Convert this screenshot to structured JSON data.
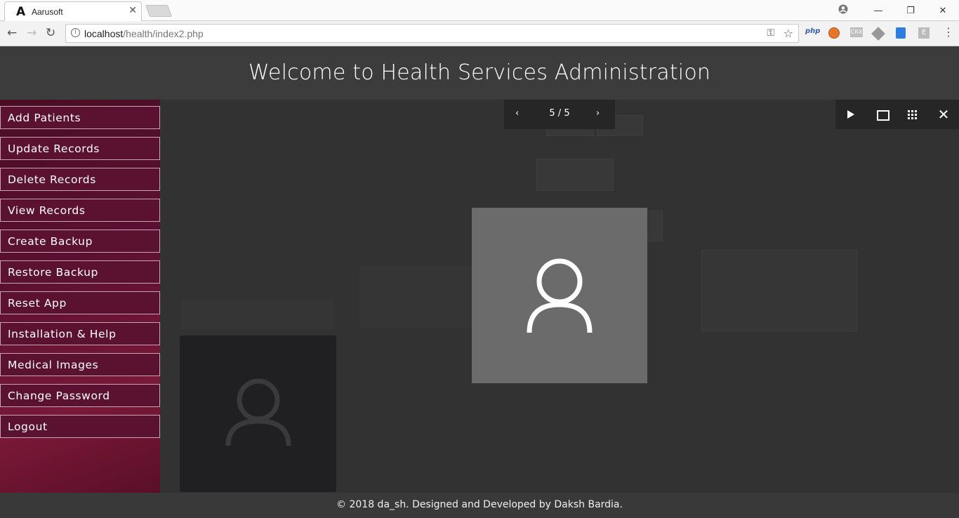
{
  "browser": {
    "tab_title": "Aarusoft",
    "tab_logo": "A",
    "tab_close": "✕",
    "url_host": "localhost",
    "url_path": "/health/index2.php",
    "ext_php": "php",
    "ext_crx": "CRX",
    "ext_e": "E",
    "window_minimize": "—",
    "window_restore": "❐",
    "window_close": "✕"
  },
  "header": {
    "title": "Welcome to Health Services Administration"
  },
  "sidebar": {
    "items": [
      {
        "label": "Add Patients"
      },
      {
        "label": "Update Records"
      },
      {
        "label": "Delete Records"
      },
      {
        "label": "View Records"
      },
      {
        "label": "Create Backup"
      },
      {
        "label": "Restore Backup"
      },
      {
        "label": "Reset App"
      },
      {
        "label": "Installation & Help"
      },
      {
        "label": "Medical Images"
      },
      {
        "label": "Change Password"
      },
      {
        "label": "Logout"
      }
    ]
  },
  "lightbox": {
    "counter": "5 / 5",
    "prev_icon": "chevron-left-icon",
    "next_icon": "chevron-right-icon",
    "tools": [
      "play-icon",
      "fit-screen-icon",
      "grid-icon",
      "close-icon"
    ]
  },
  "footer": {
    "text": "© 2018 da_sh. Designed and Developed by Daksh Bardia."
  },
  "colors": {
    "sidebar": "#5b1130",
    "page_bg": "#3b3b3b",
    "lightbox_bar": "#262626",
    "lightbox_image": "#6b6b6b"
  }
}
